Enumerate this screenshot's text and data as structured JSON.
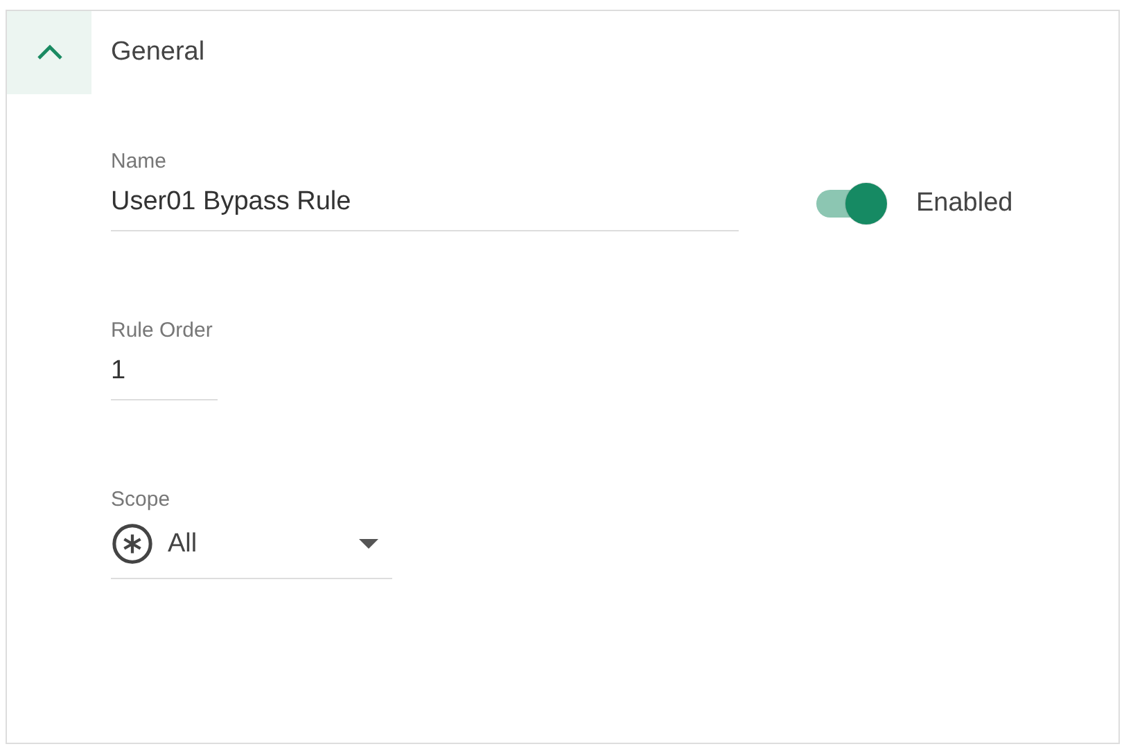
{
  "section": {
    "title": "General",
    "expanded": true
  },
  "name_field": {
    "label": "Name",
    "value": "User01 Bypass Rule"
  },
  "enabled_toggle": {
    "label": "Enabled",
    "on": true
  },
  "rule_order_field": {
    "label": "Rule Order",
    "value": "1"
  },
  "scope_select": {
    "label": "Scope",
    "value": "All"
  }
}
